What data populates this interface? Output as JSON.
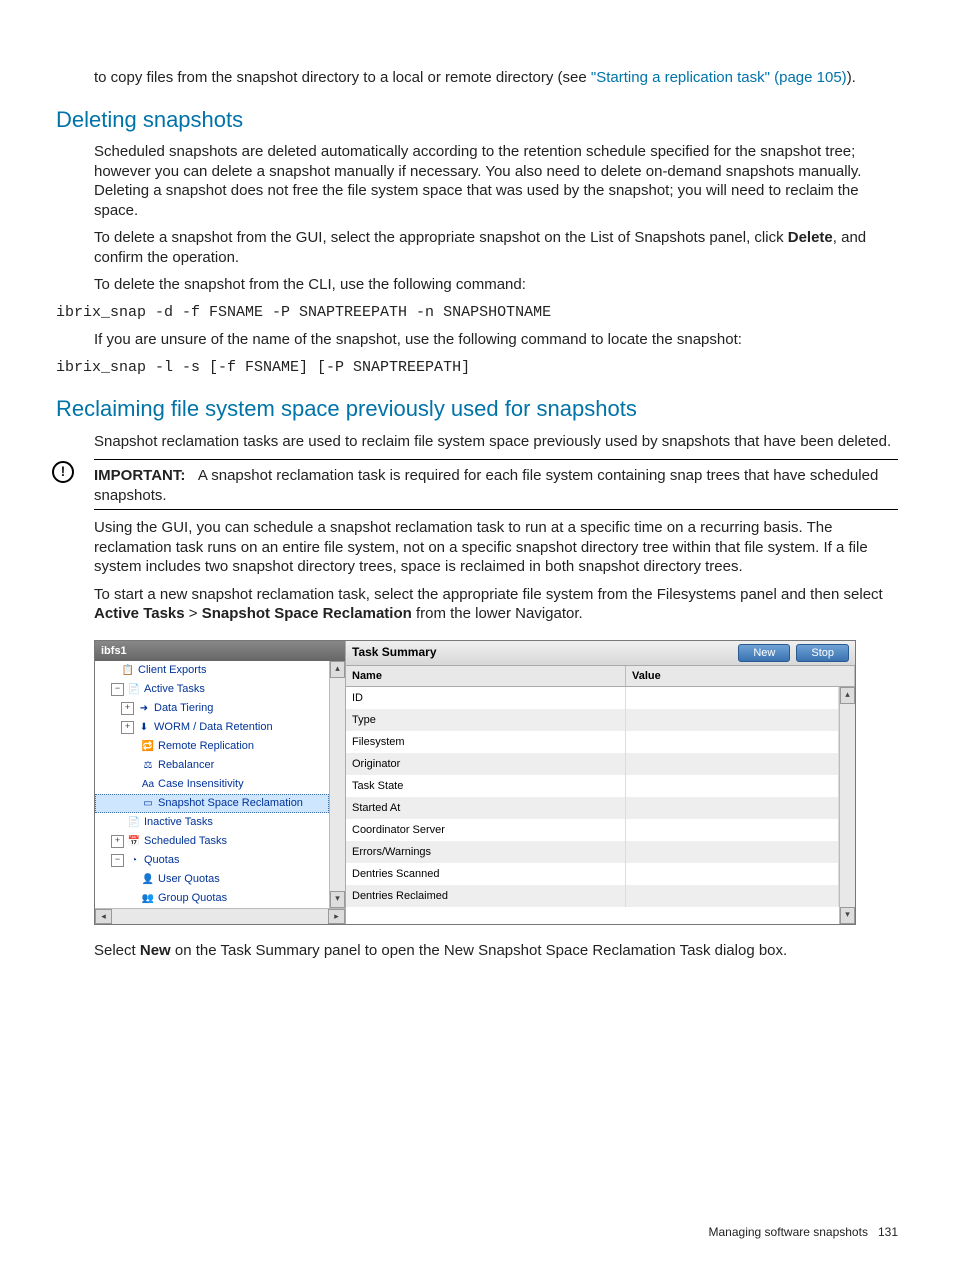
{
  "intro": {
    "text1": "to copy files from the snapshot directory to a local or remote directory (see ",
    "link": "\"Starting a replication task\" (page 105)",
    "text2": ")."
  },
  "section1": {
    "heading": "Deleting snapshots",
    "p1": "Scheduled snapshots are deleted automatically according to the retention schedule specified for the snapshot tree; however you can delete a snapshot manually if necessary. You also need to delete on-demand snapshots manually. Deleting a snapshot does not free the file system space that was used by the snapshot; you will need to reclaim the space.",
    "p2a": "To delete a snapshot from the GUI, select the appropriate snapshot on the List of Snapshots panel, click ",
    "p2b": "Delete",
    "p2c": ", and confirm the operation.",
    "p3": "To delete the snapshot from the CLI, use the following command:",
    "code1": "ibrix_snap -d -f FSNAME -P SNAPTREEPATH -n SNAPSHOTNAME",
    "p4": "If you are unsure of the name of the snapshot, use the following command to locate the snapshot:",
    "code2": "ibrix_snap -l -s [-f FSNAME] [-P SNAPTREEPATH]"
  },
  "section2": {
    "heading": "Reclaiming file system space previously used for snapshots",
    "p1": "Snapshot reclamation tasks are used to reclaim file system space previously used by snapshots that have been deleted.",
    "important_label": "IMPORTANT:",
    "important_text": "A snapshot reclamation task is required for each file system containing snap trees that have scheduled snapshots.",
    "p2": "Using the GUI, you can schedule a snapshot reclamation task to run at a specific time on a recurring basis. The reclamation task runs on an entire file system, not on a specific snapshot directory tree within that file system. If a file system includes two snapshot directory trees, space is reclaimed in both snapshot directory trees.",
    "p3a": "To start a new snapshot reclamation task, select the appropriate file system from the Filesystems panel and then select ",
    "p3b": "Active Tasks",
    "p3c": " > ",
    "p3d": "Snapshot Space Reclamation",
    "p3e": " from the lower Navigator."
  },
  "gui": {
    "tree_title": "ibfs1",
    "tree": [
      {
        "indent": 22,
        "toggle": "",
        "icon": "📋",
        "label": "Client Exports"
      },
      {
        "indent": 12,
        "toggle": "−",
        "icon": "📄",
        "label": "Active Tasks"
      },
      {
        "indent": 22,
        "toggle": "+",
        "icon": "➜",
        "label": "Data Tiering"
      },
      {
        "indent": 22,
        "toggle": "+",
        "icon": "⬇",
        "label": "WORM / Data Retention"
      },
      {
        "indent": 42,
        "toggle": "",
        "icon": "🔁",
        "label": "Remote Replication"
      },
      {
        "indent": 42,
        "toggle": "",
        "icon": "⚖",
        "label": "Rebalancer"
      },
      {
        "indent": 42,
        "toggle": "",
        "icon": "Aa",
        "label": "Case Insensitivity"
      },
      {
        "indent": 42,
        "toggle": "",
        "icon": "▭",
        "label": "Snapshot Space Reclamation",
        "selected": true
      },
      {
        "indent": 28,
        "toggle": "",
        "icon": "📄",
        "label": "Inactive Tasks"
      },
      {
        "indent": 12,
        "toggle": "+",
        "icon": "📅",
        "label": "Scheduled Tasks"
      },
      {
        "indent": 12,
        "toggle": "−",
        "icon": "◔",
        "label": "Quotas"
      },
      {
        "indent": 42,
        "toggle": "",
        "icon": "👤",
        "label": "User Quotas"
      },
      {
        "indent": 42,
        "toggle": "",
        "icon": "👥",
        "label": "Group Quotas"
      }
    ],
    "summary_title": "Task Summary",
    "btn_new": "New",
    "btn_stop": "Stop",
    "col_name": "Name",
    "col_value": "Value",
    "rows": [
      {
        "name": "ID",
        "value": ""
      },
      {
        "name": "Type",
        "value": ""
      },
      {
        "name": "Filesystem",
        "value": ""
      },
      {
        "name": "Originator",
        "value": ""
      },
      {
        "name": "Task State",
        "value": ""
      },
      {
        "name": "Started At",
        "value": ""
      },
      {
        "name": "Coordinator Server",
        "value": ""
      },
      {
        "name": "Errors/Warnings",
        "value": ""
      },
      {
        "name": "Dentries Scanned",
        "value": ""
      },
      {
        "name": "Dentries Reclaimed",
        "value": ""
      }
    ]
  },
  "after_gui": {
    "a": "Select ",
    "b": "New",
    "c": " on the Task Summary panel to open the New Snapshot Space Reclamation Task dialog box."
  },
  "footer": {
    "text": "Managing software snapshots",
    "page": "131"
  }
}
